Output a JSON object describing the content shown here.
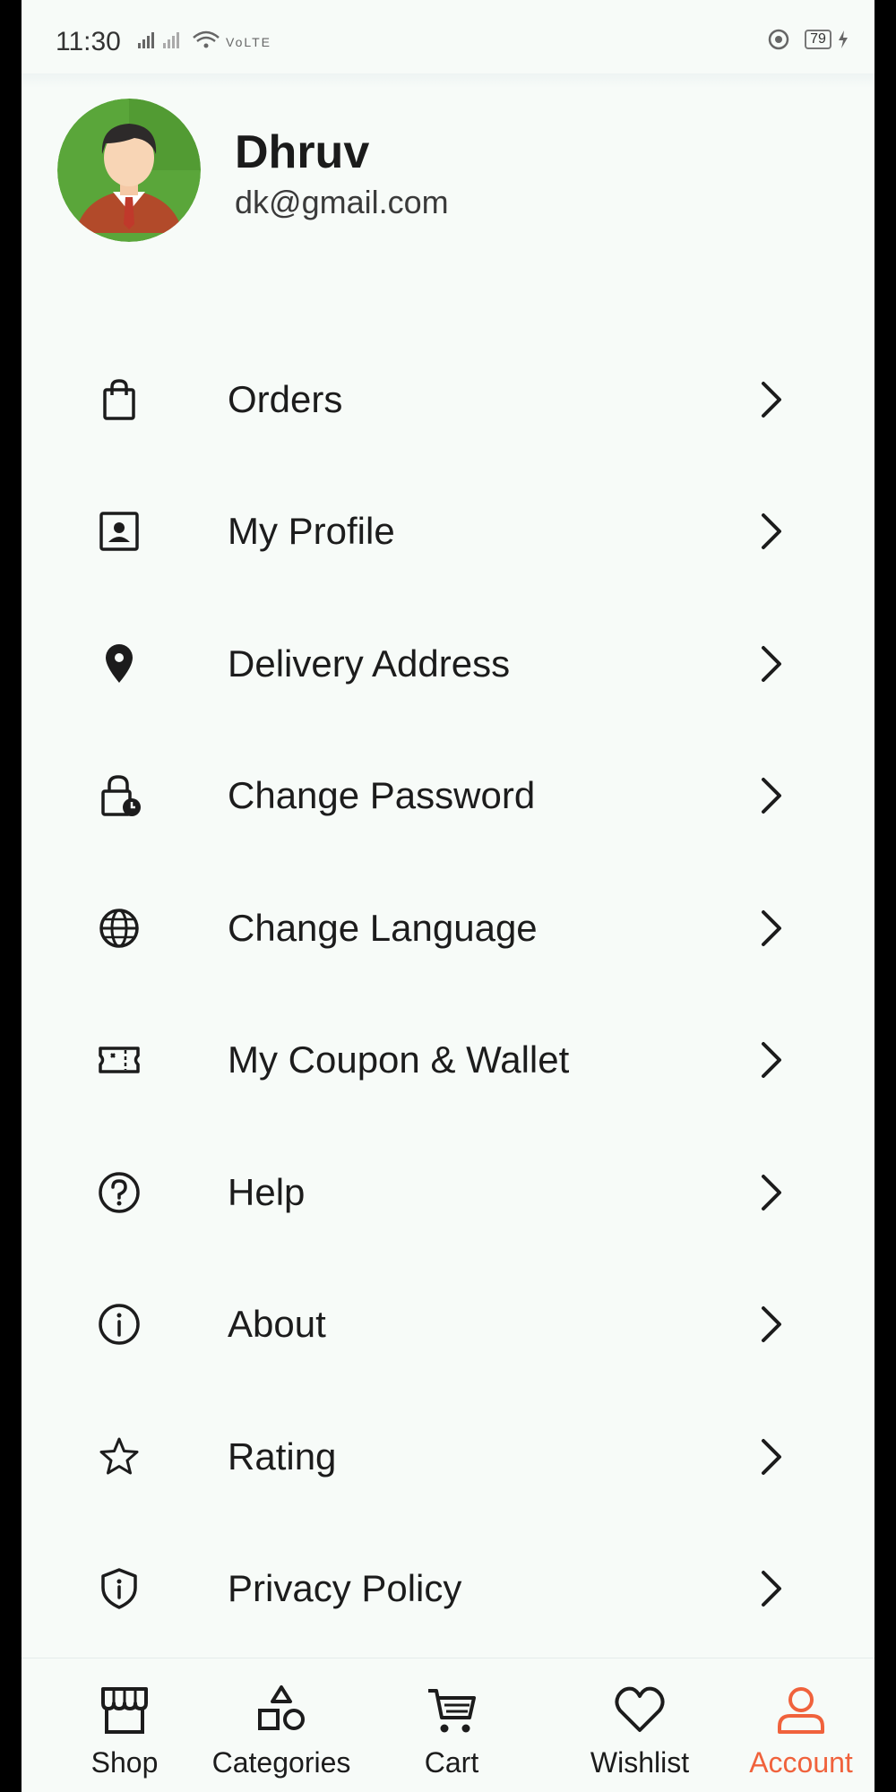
{
  "status_bar": {
    "time": "11:30",
    "battery": "79"
  },
  "profile": {
    "name": "Dhruv",
    "email": "dk@gmail.com"
  },
  "menu": [
    {
      "label": "Orders",
      "icon": "shopping-bag-icon"
    },
    {
      "label": "My Profile",
      "icon": "profile-card-icon"
    },
    {
      "label": "Delivery Address",
      "icon": "location-pin-icon"
    },
    {
      "label": "Change Password",
      "icon": "lock-clock-icon"
    },
    {
      "label": "Change Language",
      "icon": "globe-icon"
    },
    {
      "label": "My Coupon & Wallet",
      "icon": "coupon-icon"
    },
    {
      "label": "Help",
      "icon": "help-icon"
    },
    {
      "label": "About",
      "icon": "info-icon"
    },
    {
      "label": "Rating",
      "icon": "star-icon"
    },
    {
      "label": "Privacy Policy",
      "icon": "shield-icon"
    }
  ],
  "bottom_nav": [
    {
      "label": "Shop",
      "icon": "store-icon",
      "active": false
    },
    {
      "label": "Categories",
      "icon": "categories-icon",
      "active": false
    },
    {
      "label": "Cart",
      "icon": "cart-icon",
      "active": false
    },
    {
      "label": "Wishlist",
      "icon": "heart-icon",
      "active": false
    },
    {
      "label": "Account",
      "icon": "user-icon",
      "active": true
    }
  ],
  "colors": {
    "accent": "#f0623c",
    "background": "#f7fbf8",
    "text": "#1c1c1c"
  }
}
